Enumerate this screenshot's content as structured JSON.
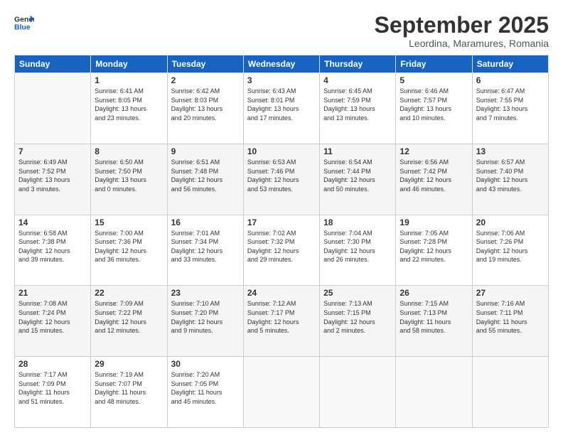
{
  "header": {
    "logo_line1": "General",
    "logo_line2": "Blue",
    "month": "September 2025",
    "location": "Leordina, Maramures, Romania"
  },
  "weekdays": [
    "Sunday",
    "Monday",
    "Tuesday",
    "Wednesday",
    "Thursday",
    "Friday",
    "Saturday"
  ],
  "weeks": [
    [
      {
        "day": "",
        "info": ""
      },
      {
        "day": "1",
        "info": "Sunrise: 6:41 AM\nSunset: 8:05 PM\nDaylight: 13 hours\nand 23 minutes."
      },
      {
        "day": "2",
        "info": "Sunrise: 6:42 AM\nSunset: 8:03 PM\nDaylight: 13 hours\nand 20 minutes."
      },
      {
        "day": "3",
        "info": "Sunrise: 6:43 AM\nSunset: 8:01 PM\nDaylight: 13 hours\nand 17 minutes."
      },
      {
        "day": "4",
        "info": "Sunrise: 6:45 AM\nSunset: 7:59 PM\nDaylight: 13 hours\nand 13 minutes."
      },
      {
        "day": "5",
        "info": "Sunrise: 6:46 AM\nSunset: 7:57 PM\nDaylight: 13 hours\nand 10 minutes."
      },
      {
        "day": "6",
        "info": "Sunrise: 6:47 AM\nSunset: 7:55 PM\nDaylight: 13 hours\nand 7 minutes."
      }
    ],
    [
      {
        "day": "7",
        "info": "Sunrise: 6:49 AM\nSunset: 7:52 PM\nDaylight: 13 hours\nand 3 minutes."
      },
      {
        "day": "8",
        "info": "Sunrise: 6:50 AM\nSunset: 7:50 PM\nDaylight: 13 hours\nand 0 minutes."
      },
      {
        "day": "9",
        "info": "Sunrise: 6:51 AM\nSunset: 7:48 PM\nDaylight: 12 hours\nand 56 minutes."
      },
      {
        "day": "10",
        "info": "Sunrise: 6:53 AM\nSunset: 7:46 PM\nDaylight: 12 hours\nand 53 minutes."
      },
      {
        "day": "11",
        "info": "Sunrise: 6:54 AM\nSunset: 7:44 PM\nDaylight: 12 hours\nand 50 minutes."
      },
      {
        "day": "12",
        "info": "Sunrise: 6:56 AM\nSunset: 7:42 PM\nDaylight: 12 hours\nand 46 minutes."
      },
      {
        "day": "13",
        "info": "Sunrise: 6:57 AM\nSunset: 7:40 PM\nDaylight: 12 hours\nand 43 minutes."
      }
    ],
    [
      {
        "day": "14",
        "info": "Sunrise: 6:58 AM\nSunset: 7:38 PM\nDaylight: 12 hours\nand 39 minutes."
      },
      {
        "day": "15",
        "info": "Sunrise: 7:00 AM\nSunset: 7:36 PM\nDaylight: 12 hours\nand 36 minutes."
      },
      {
        "day": "16",
        "info": "Sunrise: 7:01 AM\nSunset: 7:34 PM\nDaylight: 12 hours\nand 33 minutes."
      },
      {
        "day": "17",
        "info": "Sunrise: 7:02 AM\nSunset: 7:32 PM\nDaylight: 12 hours\nand 29 minutes."
      },
      {
        "day": "18",
        "info": "Sunrise: 7:04 AM\nSunset: 7:30 PM\nDaylight: 12 hours\nand 26 minutes."
      },
      {
        "day": "19",
        "info": "Sunrise: 7:05 AM\nSunset: 7:28 PM\nDaylight: 12 hours\nand 22 minutes."
      },
      {
        "day": "20",
        "info": "Sunrise: 7:06 AM\nSunset: 7:26 PM\nDaylight: 12 hours\nand 19 minutes."
      }
    ],
    [
      {
        "day": "21",
        "info": "Sunrise: 7:08 AM\nSunset: 7:24 PM\nDaylight: 12 hours\nand 15 minutes."
      },
      {
        "day": "22",
        "info": "Sunrise: 7:09 AM\nSunset: 7:22 PM\nDaylight: 12 hours\nand 12 minutes."
      },
      {
        "day": "23",
        "info": "Sunrise: 7:10 AM\nSunset: 7:20 PM\nDaylight: 12 hours\nand 9 minutes."
      },
      {
        "day": "24",
        "info": "Sunrise: 7:12 AM\nSunset: 7:17 PM\nDaylight: 12 hours\nand 5 minutes."
      },
      {
        "day": "25",
        "info": "Sunrise: 7:13 AM\nSunset: 7:15 PM\nDaylight: 12 hours\nand 2 minutes."
      },
      {
        "day": "26",
        "info": "Sunrise: 7:15 AM\nSunset: 7:13 PM\nDaylight: 11 hours\nand 58 minutes."
      },
      {
        "day": "27",
        "info": "Sunrise: 7:16 AM\nSunset: 7:11 PM\nDaylight: 11 hours\nand 55 minutes."
      }
    ],
    [
      {
        "day": "28",
        "info": "Sunrise: 7:17 AM\nSunset: 7:09 PM\nDaylight: 11 hours\nand 51 minutes."
      },
      {
        "day": "29",
        "info": "Sunrise: 7:19 AM\nSunset: 7:07 PM\nDaylight: 11 hours\nand 48 minutes."
      },
      {
        "day": "30",
        "info": "Sunrise: 7:20 AM\nSunset: 7:05 PM\nDaylight: 11 hours\nand 45 minutes."
      },
      {
        "day": "",
        "info": ""
      },
      {
        "day": "",
        "info": ""
      },
      {
        "day": "",
        "info": ""
      },
      {
        "day": "",
        "info": ""
      }
    ]
  ]
}
